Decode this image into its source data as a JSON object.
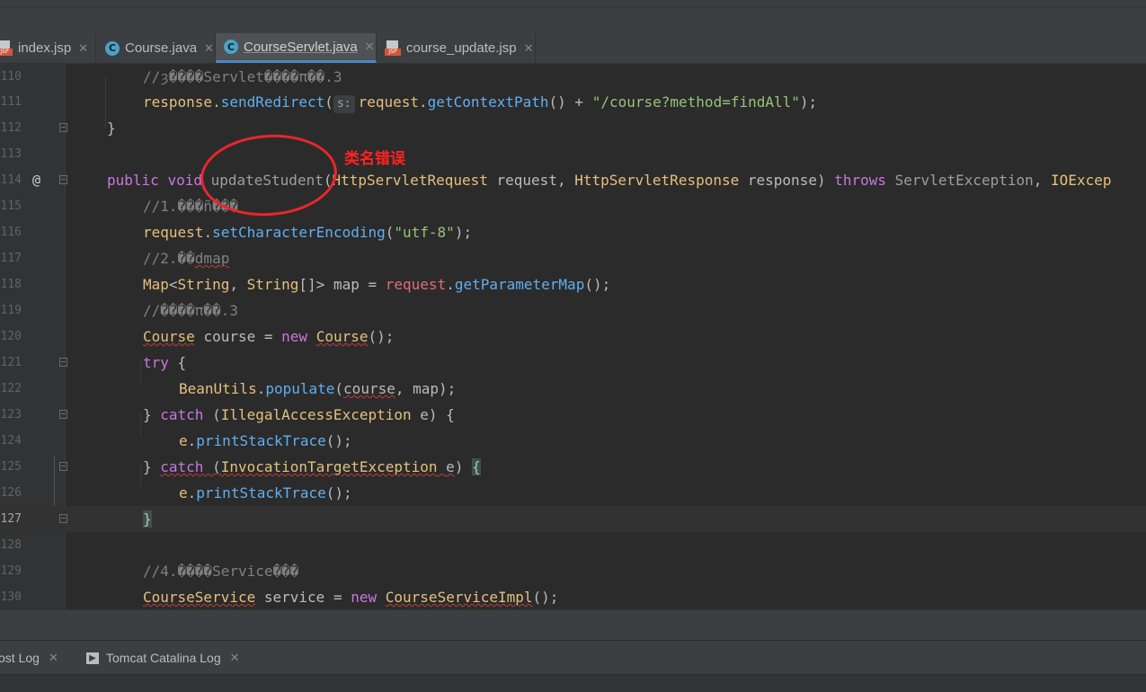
{
  "tabs": [
    {
      "label": "index.jsp",
      "icon": "jsp-file-icon",
      "active": false
    },
    {
      "label": "Course.java",
      "icon": "java-class-icon",
      "active": false
    },
    {
      "label": "CourseServlet.java",
      "icon": "java-class-icon",
      "active": true
    },
    {
      "label": "course_update.jsp",
      "icon": "jsp-file-icon",
      "active": false
    }
  ],
  "jsp_badge": "JSP",
  "class_badge": "C",
  "close_glyph": "✕",
  "lines": {
    "l110": {
      "num": "110",
      "comment": "//ȝ����Servlet����π��.3"
    },
    "l111": {
      "num": "111",
      "obj": "response",
      "method": "sendRedirect",
      "hint": "s:",
      "arg_obj": "request",
      "arg_method": "getContextPath",
      "str": "\"/course?method=findAll\""
    },
    "l112": {
      "num": "112",
      "text": "}"
    },
    "l113": {
      "num": "113"
    },
    "l114": {
      "num": "114",
      "mod": "public",
      "ret": "void",
      "name": "updateStudent",
      "p1type": "HttpServletRequest",
      "p1": "request",
      "p2type": "HttpServletResponse",
      "p2": "response",
      "throws": "throws",
      "ex1": "ServletException",
      "ex2": "IOExcep"
    },
    "l115": {
      "num": "115",
      "comment": "//1.���ñ���"
    },
    "l116": {
      "num": "116",
      "obj": "request",
      "method": "setCharacterEncoding",
      "str": "\"utf-8\""
    },
    "l117": {
      "num": "117",
      "comment": "//2.��",
      "comment2": "dmap"
    },
    "l118": {
      "num": "118",
      "type": "Map",
      "t1": "String",
      "t2": "String",
      "var": "map",
      "obj": "request",
      "method": "getParameterMap"
    },
    "l119": {
      "num": "119",
      "comment": "//����π��.3"
    },
    "l120": {
      "num": "120",
      "type": "Course",
      "var": "course",
      "kw": "new",
      "ctor": "Course"
    },
    "l121": {
      "num": "121",
      "kw": "try"
    },
    "l122": {
      "num": "122",
      "cls": "BeanUtils",
      "method": "populate",
      "a1": "course",
      "a2": "map"
    },
    "l123": {
      "num": "123",
      "kw": "catch",
      "ex": "IllegalAccessException",
      "var": "e"
    },
    "l124": {
      "num": "124",
      "obj": "e",
      "method": "printStackTrace"
    },
    "l125": {
      "num": "125",
      "kw": "catch",
      "ex": "InvocationTargetException",
      "var": "e"
    },
    "l126": {
      "num": "126",
      "obj": "e",
      "method": "printStackTrace"
    },
    "l127": {
      "num": "127",
      "text": "}"
    },
    "l128": {
      "num": "128"
    },
    "l129": {
      "num": "129",
      "comment": "//4.����Service��",
      "comment2": "�"
    },
    "l130": {
      "num": "130",
      "type": "CourseService",
      "var": "service",
      "kw": "new",
      "ctor": "CourseServiceImpl"
    }
  },
  "override_marker": "@",
  "annotation": {
    "text": "类名错误",
    "color": "#ff2222"
  },
  "bottom_tabs": [
    {
      "label": "ost Log",
      "icon": ""
    },
    {
      "label": "Tomcat Catalina Log",
      "icon": "terminal-icon"
    }
  ],
  "colors": {
    "accent": "#4a88c7",
    "background": "#2b2b2b"
  }
}
